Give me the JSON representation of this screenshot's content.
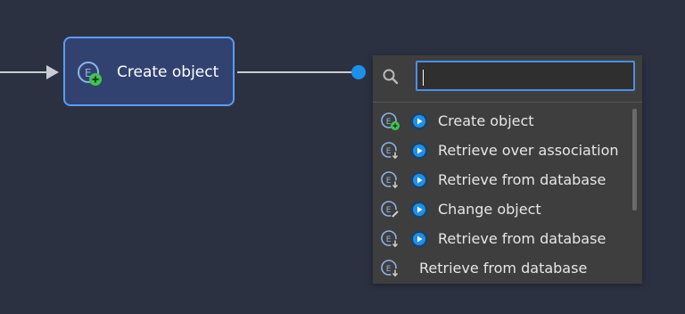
{
  "node": {
    "label": "Create object",
    "icon": "create-object-icon"
  },
  "popup": {
    "search": {
      "value": "",
      "placeholder": ""
    },
    "items": [
      {
        "label": "Create object",
        "icon": "create-object-icon",
        "has_play": true
      },
      {
        "label": "Retrieve over association",
        "icon": "retrieve-icon",
        "has_play": true
      },
      {
        "label": "Retrieve from database",
        "icon": "retrieve-icon",
        "has_play": true
      },
      {
        "label": "Change object",
        "icon": "change-object-icon",
        "has_play": true
      },
      {
        "label": "Retrieve from database",
        "icon": "retrieve-icon",
        "has_play": true
      },
      {
        "label": "Retrieve from database",
        "icon": "retrieve-icon",
        "has_play": false
      }
    ]
  },
  "colors": {
    "background": "#2c3142",
    "node_fill": "#314270",
    "node_border": "#5b9cf4",
    "accent_blue": "#1e90e8",
    "popup_bg": "#3e3e3e",
    "create_green": "#3fc54f"
  }
}
